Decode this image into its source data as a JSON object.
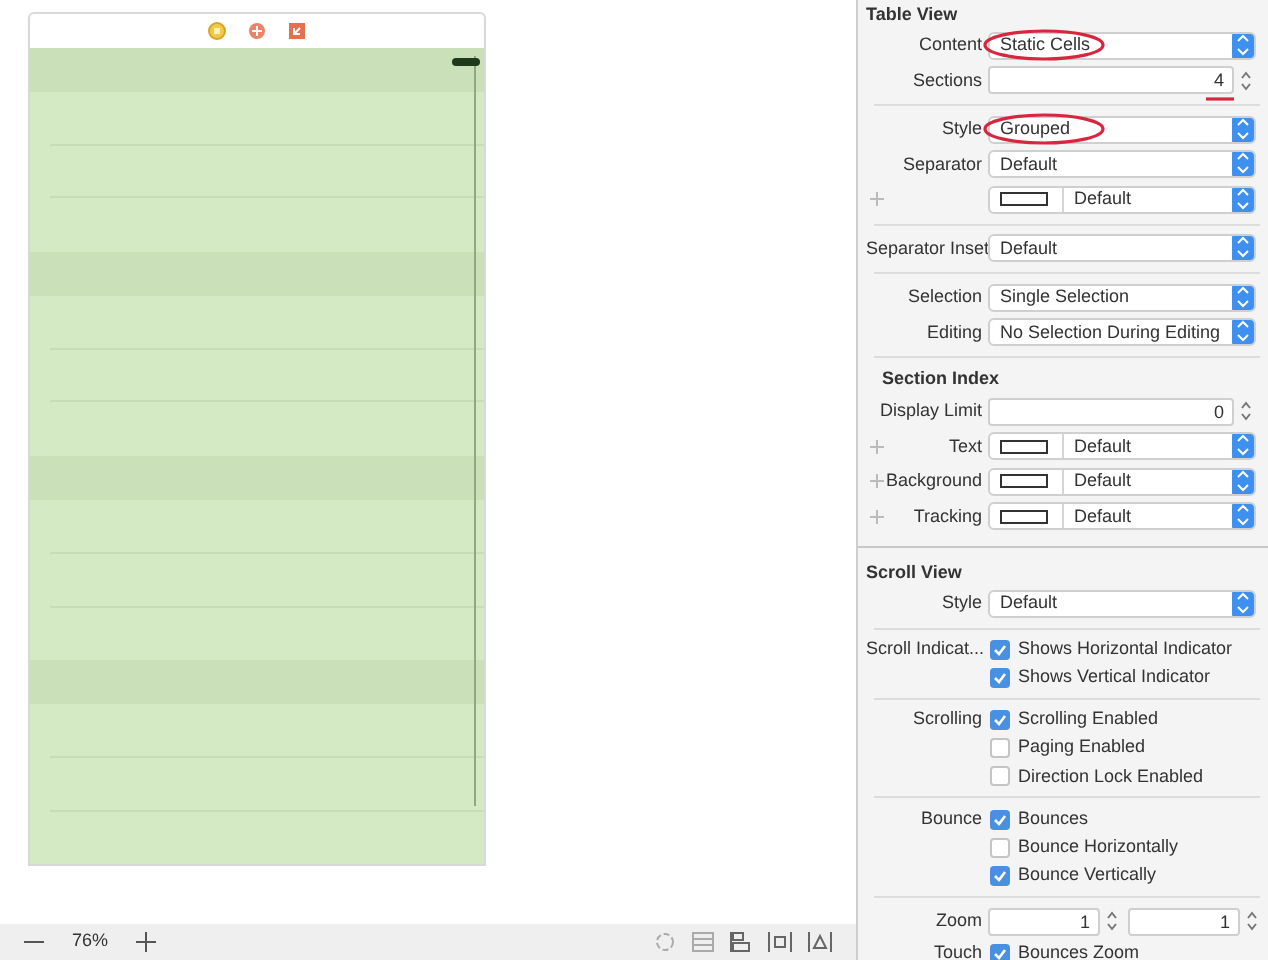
{
  "canvas": {
    "scene": {
      "sections": [
        {
          "cells": [
            {
              "kind": "cell"
            },
            {
              "kind": "cell"
            },
            {
              "kind": "cell"
            }
          ]
        },
        {
          "cells": [
            {
              "kind": "cell"
            },
            {
              "kind": "cell"
            },
            {
              "kind": "cell"
            }
          ]
        },
        {
          "cells": [
            {
              "kind": "cell"
            },
            {
              "kind": "cell"
            },
            {
              "kind": "cell"
            }
          ]
        },
        {
          "cells": [
            {
              "kind": "cell"
            },
            {
              "kind": "cell"
            },
            {
              "kind": "cell"
            }
          ]
        }
      ]
    },
    "zoom_bar": {
      "zoom_level": "76%"
    }
  },
  "inspector": {
    "sections": [
      {
        "title": "Table View",
        "rows": [
          {
            "kind": "popup",
            "label": "Content",
            "value": "Static Cells",
            "circled": true
          },
          {
            "kind": "stepper",
            "label": "Sections",
            "value": "4",
            "underlined": true
          },
          {
            "kind": "divider"
          },
          {
            "kind": "popup",
            "label": "Style",
            "value": "Grouped",
            "circled": true
          },
          {
            "kind": "popup",
            "label": "Separator",
            "value": "Default"
          },
          {
            "kind": "color",
            "value": "Default"
          },
          {
            "kind": "divider"
          },
          {
            "kind": "popup",
            "label": "Separator Inset",
            "value": "Default"
          },
          {
            "kind": "divider"
          },
          {
            "kind": "popup",
            "label": "Selection",
            "value": "Single Selection"
          },
          {
            "kind": "popup",
            "label": "Editing",
            "value": "No Selection During Editing"
          },
          {
            "kind": "divider"
          },
          {
            "kind": "subheader",
            "text": "Section Index"
          },
          {
            "kind": "stepper",
            "label": "Display Limit",
            "value": "0"
          },
          {
            "kind": "color",
            "label": "Text",
            "value": "Default"
          },
          {
            "kind": "color",
            "label": "Background",
            "value": "Default"
          },
          {
            "kind": "color",
            "label": "Tracking",
            "value": "Default"
          }
        ]
      },
      {
        "title": "Scroll View",
        "rows": [
          {
            "kind": "popup",
            "label": "Style",
            "value": "Default"
          },
          {
            "kind": "divider"
          },
          {
            "kind": "check",
            "label": "Scroll Indicat...",
            "text": "Shows Horizontal Indicator",
            "checked": true
          },
          {
            "kind": "check",
            "text": "Shows Vertical Indicator",
            "checked": true
          },
          {
            "kind": "divider"
          },
          {
            "kind": "check",
            "label": "Scrolling",
            "text": "Scrolling Enabled",
            "checked": true
          },
          {
            "kind": "check",
            "text": "Paging Enabled",
            "checked": false
          },
          {
            "kind": "check",
            "text": "Direction Lock Enabled",
            "checked": false
          },
          {
            "kind": "divider"
          },
          {
            "kind": "check",
            "label": "Bounce",
            "text": "Bounces",
            "checked": true
          },
          {
            "kind": "check",
            "text": "Bounce Horizontally",
            "checked": false
          },
          {
            "kind": "check",
            "text": "Bounce Vertically",
            "checked": true
          },
          {
            "kind": "divider"
          },
          {
            "kind": "steppers",
            "label": "Zoom",
            "values": [
              "1",
              "1"
            ]
          },
          {
            "kind": "check",
            "label": "Touch",
            "text": "Bounces Zoom",
            "checked": true
          }
        ]
      }
    ]
  }
}
